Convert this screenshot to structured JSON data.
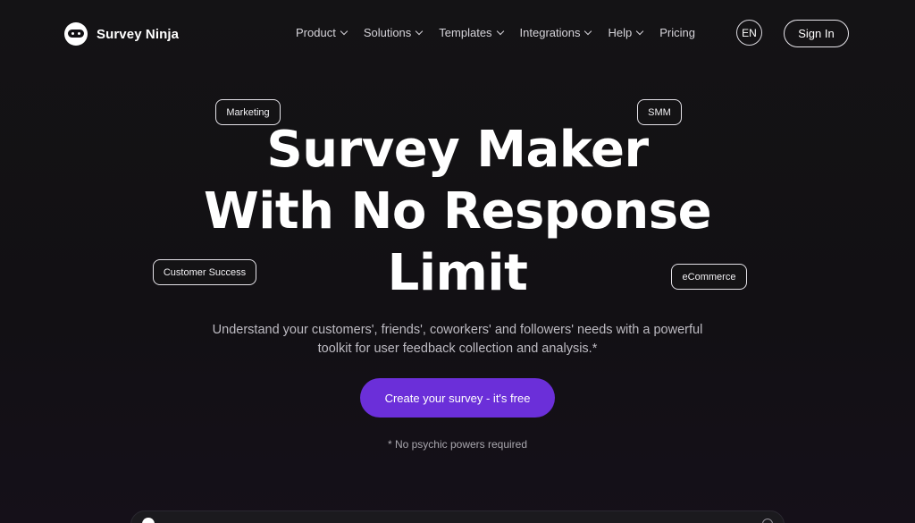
{
  "brand": {
    "name": "Survey Ninja",
    "icon": "ninja-logo-icon"
  },
  "nav": {
    "items": [
      {
        "label": "Product",
        "has_dropdown": true
      },
      {
        "label": "Solutions",
        "has_dropdown": true
      },
      {
        "label": "Templates",
        "has_dropdown": true
      },
      {
        "label": "Integrations",
        "has_dropdown": true
      },
      {
        "label": "Help",
        "has_dropdown": true
      },
      {
        "label": "Pricing",
        "has_dropdown": false
      }
    ],
    "language": "EN",
    "signin_label": "Sign In"
  },
  "tags": {
    "marketing": "Marketing",
    "smm": "SMM",
    "customer_success": "Customer Success",
    "ecommerce": "eCommerce"
  },
  "hero": {
    "title_line1": "Survey Maker",
    "title_line2": "With No Response",
    "title_line3": "Limit",
    "subtitle_line1": "Understand your customers', friends', coworkers' and followers' needs with a powerful",
    "subtitle_line2": "toolkit for user feedback collection and analysis.*",
    "cta_label": "Create your survey - it's free",
    "note": "* No psychic powers required"
  },
  "colors": {
    "background": "#121014",
    "accent": "#6b2fd9",
    "text": "#ffffff",
    "muted": "#bdbbc2"
  }
}
